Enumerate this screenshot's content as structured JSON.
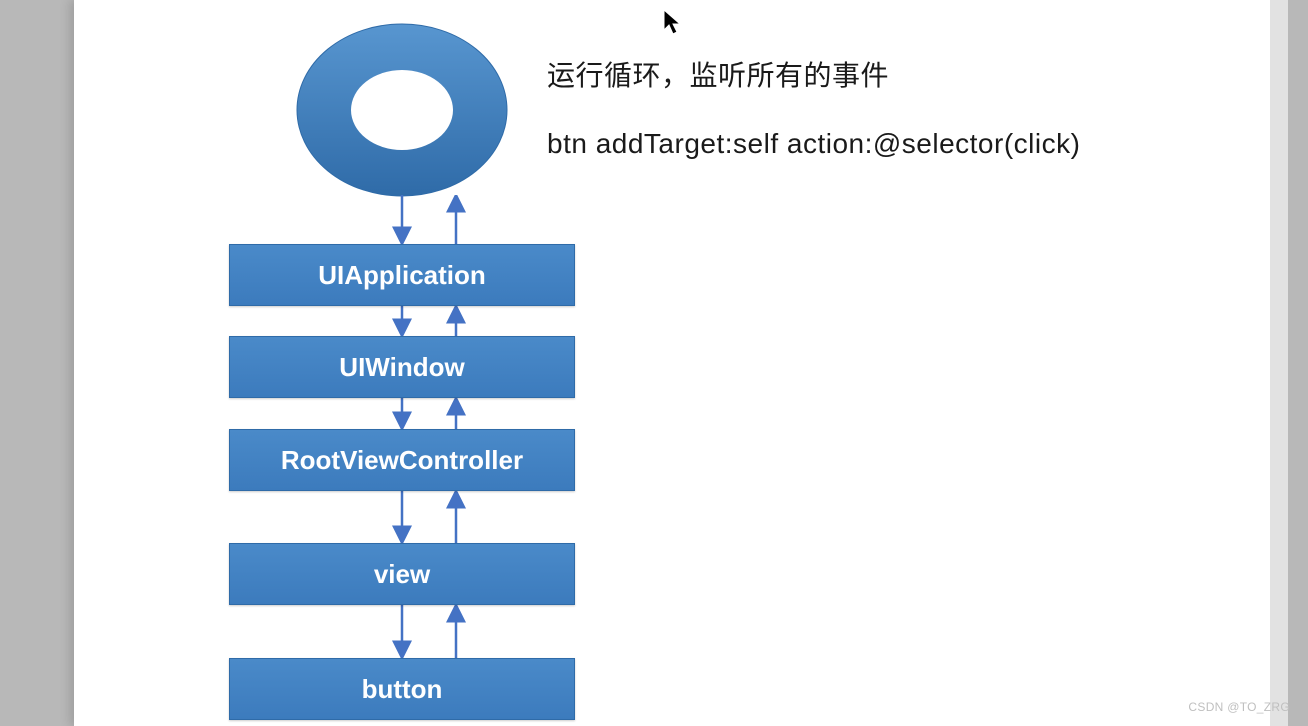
{
  "description": {
    "line1": "运行循环，监听所有的事件",
    "line2": "btn addTarget:self action:@selector(click)"
  },
  "boxes": [
    {
      "label": "UIApplication"
    },
    {
      "label": "UIWindow"
    },
    {
      "label": "RootViewController"
    },
    {
      "label": "view"
    },
    {
      "label": "button"
    }
  ],
  "colors": {
    "box_fill": "#3c7bbd",
    "arrow": "#4472c4",
    "donut": "#3c7bbd"
  },
  "watermark": "CSDN @TO_ZRG"
}
